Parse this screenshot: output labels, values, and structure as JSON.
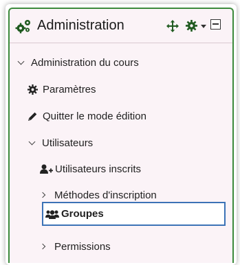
{
  "block": {
    "title": "Administration",
    "icons": [
      "cogs-icon",
      "move-icon",
      "gear-icon",
      "caret-down-icon",
      "collapse-icon"
    ]
  },
  "tree": {
    "course_admin": "Administration du cours",
    "settings": "Paramètres",
    "edit_mode_off": "Quitter le mode édition",
    "users": "Utilisateurs",
    "enrolled_users": "Utilisateurs inscrits",
    "enrolment_methods": "Méthodes d'inscription",
    "groups": "Groupes",
    "permissions": "Permissions"
  },
  "colors": {
    "border": "#3b8a3b",
    "background": "#fbf3f7",
    "selection": "#3b72b6"
  }
}
